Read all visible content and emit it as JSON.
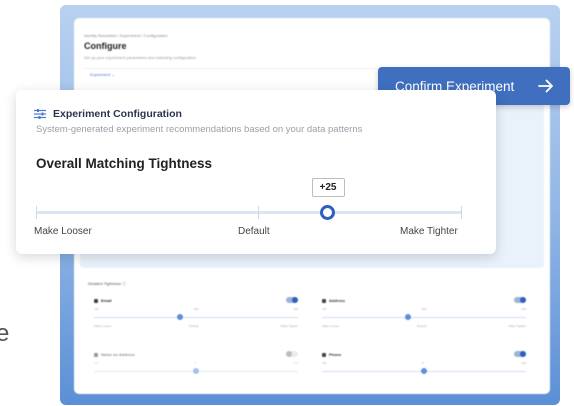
{
  "edge_letter": "e",
  "background": {
    "breadcrumb": "Identity Resolution / Experiment / Configuration",
    "title": "Configure",
    "subtitle": "Set up your experiment parameters and matching configuration",
    "tab": "Experiment ⌄",
    "detailed_title": "Detailed Tightness ⓘ",
    "cards": [
      {
        "name": "Email",
        "enabled": true,
        "min": "-50",
        "mid": "Def",
        "max": "+50",
        "knob": 0.42,
        "labels": [
          "Make Looser",
          "Default",
          "Make Tighter"
        ]
      },
      {
        "name": "Address",
        "enabled": true,
        "min": "-50",
        "mid": "Def",
        "max": "+50",
        "knob": 0.42,
        "labels": [
          "Make Looser",
          "Default",
          "Make Tighter"
        ]
      },
      {
        "name": "Name on Address",
        "enabled": false,
        "min": "-50",
        "mid": "0",
        "max": "+50",
        "knob": 0.5,
        "labels": [
          "",
          "",
          ""
        ]
      },
      {
        "name": "Phone",
        "enabled": true,
        "min": "-50",
        "mid": "0",
        "max": "+50",
        "knob": 0.5,
        "labels": [
          "",
          "",
          ""
        ]
      }
    ]
  },
  "confirm_button": {
    "label": "Confirm Experiment",
    "icon": "arrow-right-icon"
  },
  "card": {
    "icon": "sliders-icon",
    "title": "Experiment Configuration",
    "description": "System-generated experiment recommendations based on your data patterns",
    "section_title": "Overall Matching Tightness",
    "slider": {
      "value_label": "+25",
      "value": 25,
      "min": -100,
      "max": 100,
      "label_left": "Make Looser",
      "label_center": "Default",
      "label_right": "Make Tighter"
    }
  },
  "colors": {
    "accent": "#2f5fc0",
    "button": "#3f6fbe",
    "track": "#d9e7f5"
  }
}
